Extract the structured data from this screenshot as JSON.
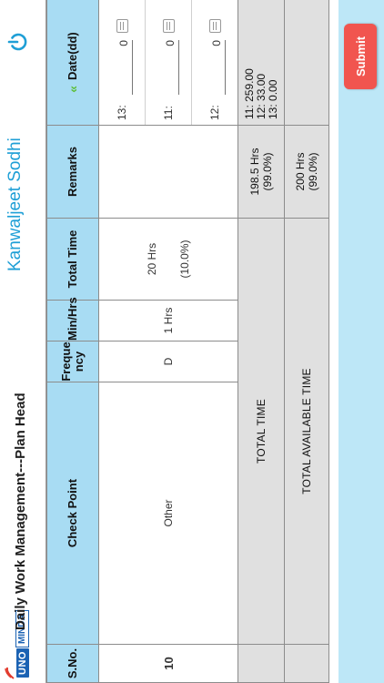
{
  "header": {
    "logo_uno": "UNO",
    "logo_minda": "MINDA",
    "title": "Daily Work Management---Plan Head",
    "user_name": "Kanwaljeet Sodhi",
    "power_icon": "power-icon"
  },
  "table": {
    "columns": {
      "sno": "S.No.",
      "check_point": "Check Point",
      "frequency": "Freque ncy",
      "min_hrs": "Min/Hrs",
      "total_time": "Total Time",
      "remarks": "Remarks",
      "date": "Date(dd)"
    },
    "row": {
      "sno": "10",
      "check_point": "Other",
      "frequency": "D",
      "min_hrs": "1 Hrs",
      "total_time_hrs": "20 Hrs",
      "total_time_pct": "(10.0%)",
      "remarks": "",
      "dates": [
        {
          "label": "13:",
          "value": "0"
        },
        {
          "label": "11:",
          "value": "0"
        },
        {
          "label": "12:",
          "value": "0"
        },
        {
          "label": "13:",
          "value": "0"
        }
      ]
    },
    "total": {
      "label": "TOTAL TIME",
      "hours": "198.5 Hrs",
      "pct": "(99.0%)",
      "dates": [
        "11: 259.00",
        "12: 33.00",
        "13: 0.00"
      ]
    },
    "available": {
      "label": "TOTAL AVAILABLE TIME",
      "hours": "200 Hrs",
      "pct": "(99.0%)"
    }
  },
  "actions": {
    "submit_label": "Submit"
  },
  "colors": {
    "header_bg": "#a8dcf3",
    "accent": "#1f9fd6",
    "submit": "#f1554f",
    "chevron": "#5ebe3a"
  }
}
